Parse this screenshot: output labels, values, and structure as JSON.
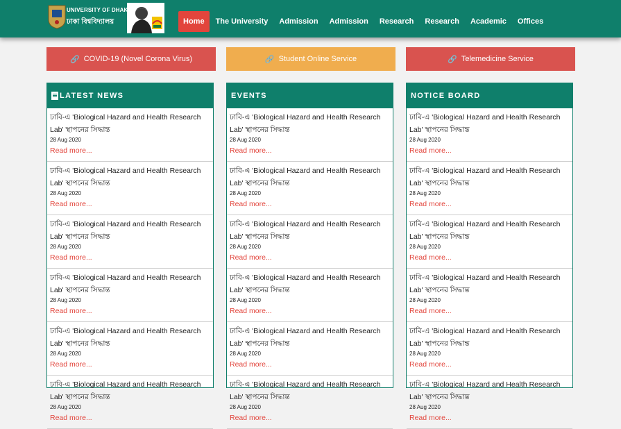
{
  "header": {
    "brand_en": "UNIVERSITY OF DHAKA",
    "brand_bn": "ঢাকা বিশ্ববিদ্যালয়",
    "nav": [
      {
        "label": "Home",
        "active": true
      },
      {
        "label": "The University"
      },
      {
        "label": "Admission"
      },
      {
        "label": "Admission"
      },
      {
        "label": "Research"
      },
      {
        "label": "Research"
      },
      {
        "label": "Academic"
      },
      {
        "label": "Offices"
      }
    ]
  },
  "services": [
    {
      "label": "COVID-19 (Novel Corona Virus)",
      "color": "#d9534f"
    },
    {
      "label": "Student Online Service",
      "color": "#f0ad4e"
    },
    {
      "label": "Telemedicine Service",
      "color": "#d9534f"
    }
  ],
  "columns": [
    {
      "title": "LATEST NEWS",
      "items": [
        {
          "title": "ঢাবি-এ 'Biological Hazard and Health Research Lab' স্থাপনের সিদ্ধান্ত",
          "date": "28 Aug 2020",
          "more": "Read more..."
        },
        {
          "title": "ঢাবি-এ 'Biological Hazard and Health Research Lab' স্থাপনের সিদ্ধান্ত",
          "date": "28 Aug 2020",
          "more": "Read more..."
        },
        {
          "title": "ঢাবি-এ 'Biological Hazard and Health Research Lab' স্থাপনের সিদ্ধান্ত",
          "date": "28 Aug 2020",
          "more": "Read more..."
        },
        {
          "title": "ঢাবি-এ 'Biological Hazard and Health Research Lab' স্থাপনের সিদ্ধান্ত",
          "date": "28 Aug 2020",
          "more": "Read more..."
        },
        {
          "title": "ঢাবি-এ 'Biological Hazard and Health Research Lab' স্থাপনের সিদ্ধান্ত",
          "date": "28 Aug 2020",
          "more": "Read more..."
        },
        {
          "title": "ঢাবি-এ 'Biological Hazard and Health Research Lab' স্থাপনের সিদ্ধান্ত",
          "date": "28 Aug 2020",
          "more": "Read more..."
        }
      ]
    },
    {
      "title": "EVENTS",
      "items": [
        {
          "title": "ঢাবি-এ 'Biological Hazard and Health Research Lab' স্থাপনের সিদ্ধান্ত",
          "date": "28 Aug 2020",
          "more": "Read more..."
        },
        {
          "title": "ঢাবি-এ 'Biological Hazard and Health Research Lab' স্থাপনের সিদ্ধান্ত",
          "date": "28 Aug 2020",
          "more": "Read more..."
        },
        {
          "title": "ঢাবি-এ 'Biological Hazard and Health Research Lab' স্থাপনের সিদ্ধান্ত",
          "date": "28 Aug 2020",
          "more": "Read more..."
        },
        {
          "title": "ঢাবি-এ 'Biological Hazard and Health Research Lab' স্থাপনের সিদ্ধান্ত",
          "date": "28 Aug 2020",
          "more": "Read more..."
        },
        {
          "title": "ঢাবি-এ 'Biological Hazard and Health Research Lab' স্থাপনের সিদ্ধান্ত",
          "date": "28 Aug 2020",
          "more": "Read more..."
        },
        {
          "title": "ঢাবি-এ 'Biological Hazard and Health Research Lab' স্থাপনের সিদ্ধান্ত",
          "date": "28 Aug 2020",
          "more": "Read more..."
        }
      ]
    },
    {
      "title": "NOTICE BOARD",
      "items": [
        {
          "title": "ঢাবি-এ 'Biological Hazard and Health Research Lab' স্থাপনের সিদ্ধান্ত",
          "date": "28 Aug 2020",
          "more": "Read more..."
        },
        {
          "title": "ঢাবি-এ 'Biological Hazard and Health Research Lab' স্থাপনের সিদ্ধান্ত",
          "date": "28 Aug 2020",
          "more": "Read more..."
        },
        {
          "title": "ঢাবি-এ 'Biological Hazard and Health Research Lab' স্থাপনের সিদ্ধান্ত",
          "date": "28 Aug 2020",
          "more": "Read more..."
        },
        {
          "title": "ঢাবি-এ 'Biological Hazard and Health Research Lab' স্থাপনের সিদ্ধান্ত",
          "date": "28 Aug 2020",
          "more": "Read more..."
        },
        {
          "title": "ঢাবি-এ 'Biological Hazard and Health Research Lab' স্থাপনের সিদ্ধান্ত",
          "date": "28 Aug 2020",
          "more": "Read more..."
        },
        {
          "title": "ঢাবি-এ 'Biological Hazard and Health Research Lab' স্থাপনের সিদ্ধান্ত",
          "date": "28 Aug 2020",
          "more": "Read more..."
        }
      ]
    }
  ]
}
